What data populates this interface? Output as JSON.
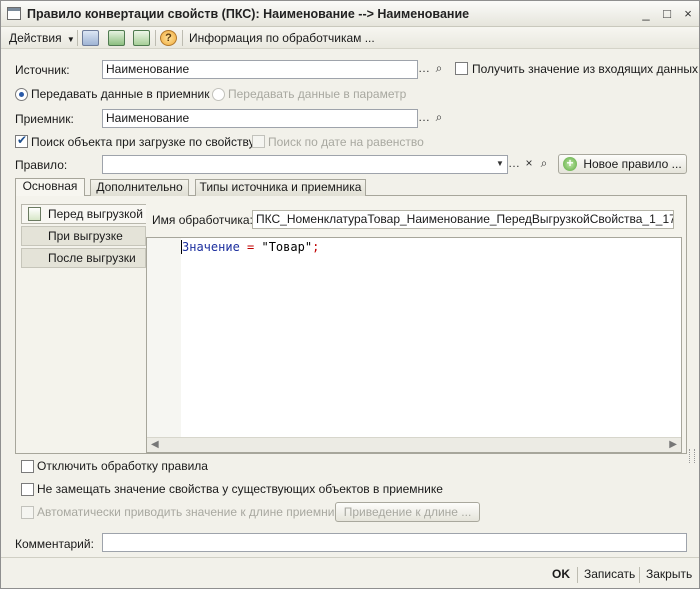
{
  "window": {
    "title": "Правило конвертации свойств (ПКС): Наименование --> Наименование",
    "controls": [
      "_",
      "□",
      "×"
    ]
  },
  "toolbar": {
    "actions_label": "Действия",
    "info_label": "Информация по обработчикам ..."
  },
  "form": {
    "source_label": "Источник:",
    "source_value": "Наименование",
    "get_from_incoming_label": "Получить значение из входящих данных",
    "pass_to_receiver_label": "Передавать данные в приемник",
    "pass_to_param_label": "Передавать данные в параметр",
    "receiver_label": "Приемник:",
    "receiver_value": "Наименование",
    "search_on_load_label": "Поиск объекта при загрузке по свойству",
    "search_by_date_label": "Поиск по дате на равенство",
    "rule_label": "Правило:",
    "rule_value": "",
    "new_rule_button": "Новое правило ..."
  },
  "tabs": [
    {
      "label": "Основная",
      "active": true
    },
    {
      "label": "Дополнительно",
      "active": false
    },
    {
      "label": "Типы источника и приемника",
      "active": false
    }
  ],
  "handler_tabs": [
    {
      "label": "Перед выгрузкой",
      "active": true
    },
    {
      "label": "При выгрузке",
      "active": false
    },
    {
      "label": "После выгрузки",
      "active": false
    }
  ],
  "handler": {
    "name_label": "Имя обработчика:",
    "name_value": "ПКС_НоменклатураТовар_Наименование_ПередВыгрузкойСвойства_1_17",
    "code_var": "Значение",
    "code_op": " = ",
    "code_str": "\"Товар\"",
    "code_end": ";"
  },
  "options": {
    "disable_rule_label": "Отключить обработку правила",
    "no_replace_label": "Не замещать значение свойства у существующих объектов в приемнике",
    "auto_length_label": "Автоматически приводить значение к длине приемника",
    "auto_length_button": "Приведение к длине ..."
  },
  "comment": {
    "label": "Комментарий:",
    "value": ""
  },
  "footer": {
    "ok": "OK",
    "save": "Записать",
    "close": "Закрыть"
  }
}
